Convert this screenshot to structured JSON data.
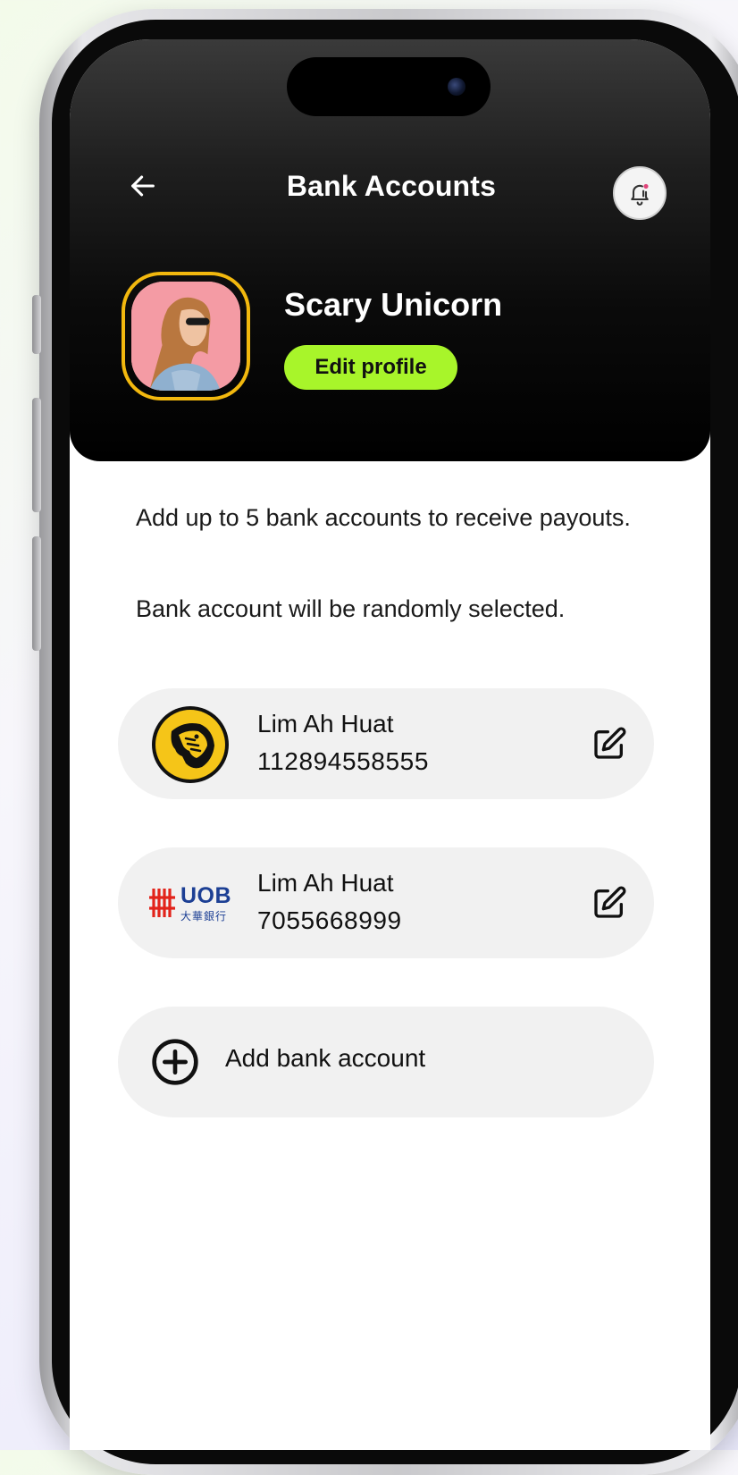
{
  "header": {
    "title": "Bank Accounts",
    "back_icon": "arrow-left-icon",
    "notification_icon": "bell-notification-icon"
  },
  "profile": {
    "name": "Scary Unicorn",
    "edit_label": "Edit profile",
    "avatar_border_color": "#f2b80e"
  },
  "info": {
    "line1": "Add up to 5 bank accounts to receive payouts.",
    "line2": "Bank account will be randomly selected."
  },
  "accounts": [
    {
      "bank_logo": "maybank-tiger-logo",
      "holder": "Lim Ah Huat",
      "number": "112894558555"
    },
    {
      "bank_logo": "uob-logo",
      "logo_text": "UOB",
      "logo_subtext": "大華銀行",
      "holder": "Lim Ah Huat",
      "number": "7055668999"
    }
  ],
  "add_account": {
    "label": "Add bank account",
    "icon": "plus-circle-icon"
  },
  "colors": {
    "accent_green": "#a8f52a",
    "maybank_yellow": "#f5c518",
    "uob_blue": "#1c3f94",
    "uob_red": "#e2231a",
    "card_bg": "#f1f1f1"
  }
}
